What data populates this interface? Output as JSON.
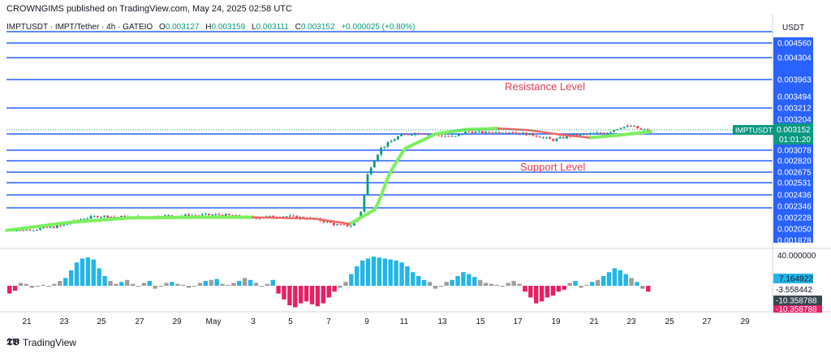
{
  "header": {
    "published": "CROWNGIMS published on TradingView.com, May 24, 2025 02:58 UTC"
  },
  "ticker": {
    "symbol": "IMPTUSDT · IMPT/Tether · 4h · GATEIO",
    "o_label": "O",
    "o": "0.003127",
    "h_label": "H",
    "h": "0.003159",
    "l_label": "L",
    "l": "0.003111",
    "c_label": "C",
    "c": "0.003152",
    "change": "+0.000025 (+0.80%)"
  },
  "price_axis": {
    "currency": "USDT",
    "levels": [
      "0.004560",
      "0.004304",
      "0.003963",
      "0.003494",
      "0.003212",
      "0.003204",
      "0.003078",
      "0.002820",
      "0.002675",
      "0.002531",
      "0.002436",
      "0.002346",
      "0.002228",
      "0.002050",
      "0.001878"
    ],
    "current_symbol": "IMPTUSDT",
    "current_price": "0.003152",
    "countdown": "01:01:20"
  },
  "annotations": {
    "resistance": "Resistance Level",
    "support": "Support Level"
  },
  "oscillator_axis": {
    "top": "40.000000",
    "v1": "7.164922",
    "v2": "-3.558442",
    "v3": "-10.358788",
    "v4": "-10.358788"
  },
  "time_axis": [
    "21",
    "23",
    "25",
    "27",
    "29",
    "May",
    "3",
    "5",
    "7",
    "9",
    "11",
    "13",
    "15",
    "17",
    "19",
    "21",
    "23",
    "25",
    "27",
    "29"
  ],
  "footer": {
    "brand": "TradingView"
  },
  "colors": {
    "level_line": "#2962ff",
    "axis_bg": "#2962ff",
    "up": "#089981",
    "down": "#f23645",
    "ma_up": "#7cf05e",
    "ma_down": "#f06767",
    "osc_up": "#22b5e8",
    "osc_down": "#e91e63",
    "osc_neutral": "#9e9e9e",
    "annotation": "#e53950"
  },
  "chart_data": {
    "type": "candlestick",
    "symbol": "IMPTUSDT",
    "timeframe": "4h",
    "horizontal_levels": [
      0.00456,
      0.004304,
      0.003963,
      0.003494,
      0.003212,
      0.003204,
      0.003078,
      0.00282,
      0.002675,
      0.002531,
      0.002436,
      0.002346,
      0.002228,
      0.00205,
      0.001878
    ],
    "price_path": [
      [
        0,
        0.00186
      ],
      [
        10,
        0.0019
      ],
      [
        18,
        0.00195
      ],
      [
        24,
        0.00205
      ],
      [
        30,
        0.0021
      ],
      [
        40,
        0.00208
      ],
      [
        50,
        0.0021
      ],
      [
        60,
        0.00211
      ],
      [
        70,
        0.00212
      ],
      [
        80,
        0.00207
      ],
      [
        90,
        0.0021
      ],
      [
        100,
        0.00206
      ],
      [
        108,
        0.00196
      ],
      [
        112,
        0.00195
      ],
      [
        115,
        0.0021
      ],
      [
        118,
        0.00255
      ],
      [
        122,
        0.00285
      ],
      [
        128,
        0.00305
      ],
      [
        134,
        0.0031
      ],
      [
        140,
        0.00306
      ],
      [
        146,
        0.00303
      ],
      [
        150,
        0.00312
      ],
      [
        156,
        0.0031
      ],
      [
        164,
        0.00312
      ],
      [
        172,
        0.00306
      ],
      [
        178,
        0.00298
      ],
      [
        184,
        0.00305
      ],
      [
        190,
        0.00308
      ],
      [
        196,
        0.00311
      ],
      [
        200,
        0.0032
      ],
      [
        204,
        0.00322
      ],
      [
        207,
        0.00315
      ],
      [
        210,
        0.00315
      ]
    ],
    "ma_path": [
      [
        0,
        0.00188
      ],
      [
        20,
        0.002
      ],
      [
        40,
        0.00207
      ],
      [
        60,
        0.00208
      ],
      [
        80,
        0.00208
      ],
      [
        100,
        0.00206
      ],
      [
        112,
        0.00198
      ],
      [
        120,
        0.0022
      ],
      [
        130,
        0.00285
      ],
      [
        140,
        0.00308
      ],
      [
        150,
        0.00316
      ],
      [
        160,
        0.00318
      ],
      [
        170,
        0.00315
      ],
      [
        180,
        0.00307
      ],
      [
        190,
        0.00302
      ],
      [
        200,
        0.00306
      ],
      [
        210,
        0.00312
      ]
    ],
    "oscillator": {
      "ylim": [
        -20,
        40
      ],
      "values": [
        -8,
        -5,
        3,
        2,
        -2,
        0,
        1,
        -1,
        2,
        5,
        8,
        16,
        24,
        28,
        29,
        27,
        18,
        10,
        5,
        2,
        4,
        6,
        2,
        -1,
        3,
        5,
        -3,
        -1,
        3,
        4,
        2,
        1,
        -2,
        0,
        3,
        5,
        6,
        7,
        2,
        1,
        3,
        5,
        8,
        6,
        3,
        -1,
        2,
        6,
        -8,
        -14,
        -20,
        -22,
        -18,
        -16,
        -19,
        -21,
        -18,
        -12,
        -6,
        -2,
        4,
        12,
        20,
        26,
        28,
        30,
        29,
        28,
        27,
        26,
        24,
        20,
        14,
        10,
        6,
        4,
        -3,
        -1,
        4,
        6,
        10,
        14,
        12,
        9,
        6,
        3,
        2,
        1,
        -1,
        3,
        5,
        2,
        -6,
        -12,
        -18,
        -16,
        -12,
        -10,
        -6,
        -4,
        3,
        5,
        -2,
        1,
        4,
        6,
        10,
        14,
        18,
        16,
        12,
        8,
        4,
        -3,
        -6
      ]
    }
  }
}
